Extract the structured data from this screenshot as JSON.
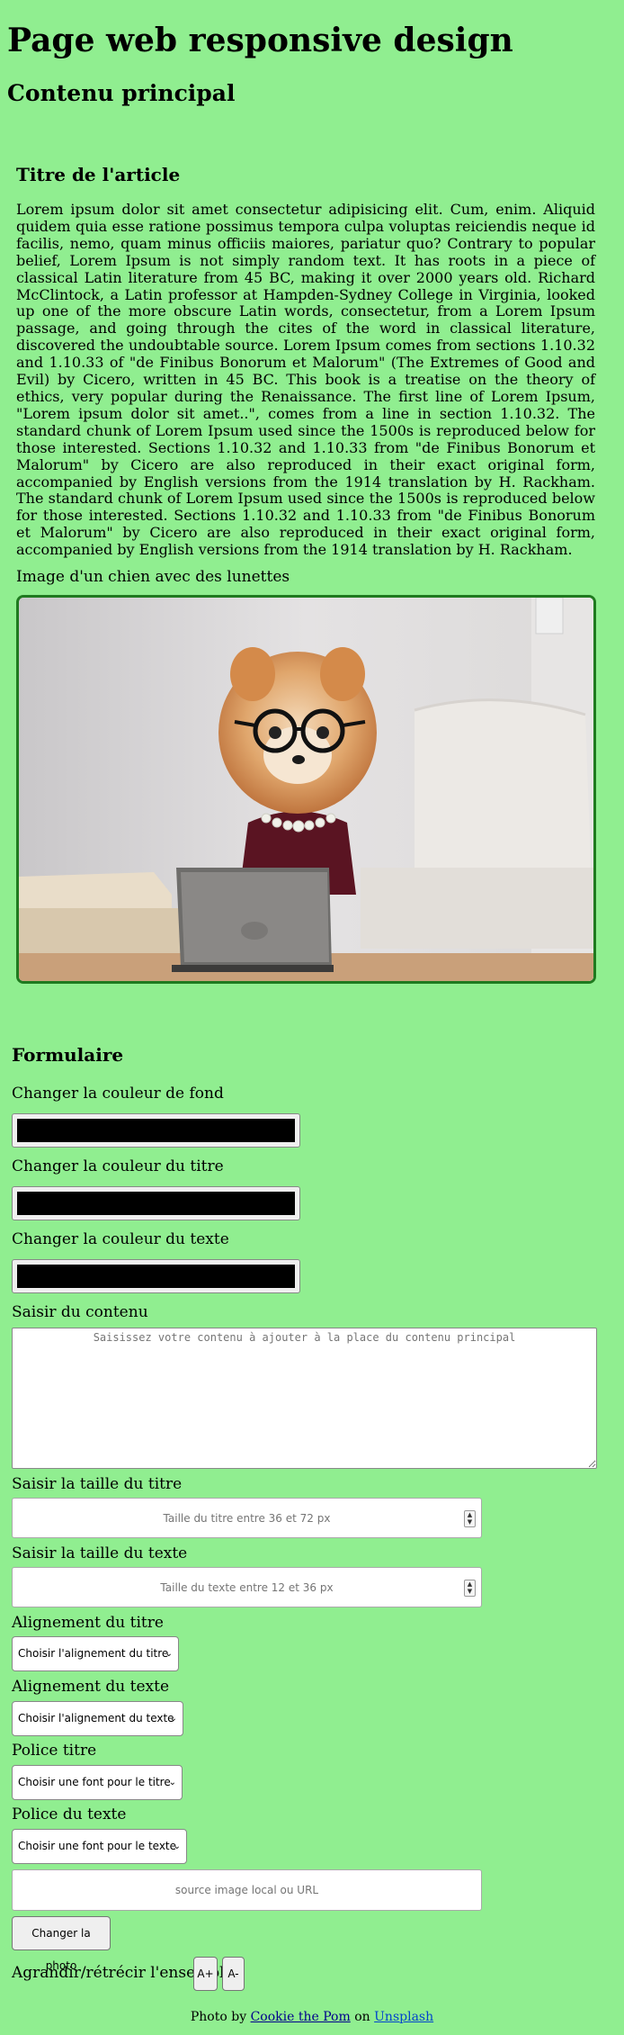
{
  "header": {
    "title": "Page web responsive design"
  },
  "main": {
    "title": "Contenu principal",
    "article": {
      "title": "Titre de l'article",
      "text": "Lorem ipsum dolor sit amet consectetur adipisicing elit. Cum, enim. Aliquid quidem quia esse ratione possimus tempora culpa voluptas reiciendis neque id facilis, nemo, quam minus officiis maiores, pariatur quo? Contrary to popular belief, Lorem Ipsum is not simply random text. It has roots in a piece of classical Latin literature from 45 BC, making it over 2000 years old. Richard McClintock, a Latin professor at Hampden-Sydney College in Virginia, looked up one of the more obscure Latin words, consectetur, from a Lorem Ipsum passage, and going through the cites of the word in classical literature, discovered the undoubtable source. Lorem Ipsum comes from sections 1.10.32 and 1.10.33 of \"de Finibus Bonorum et Malorum\" (The Extremes of Good and Evil) by Cicero, written in 45 BC. This book is a treatise on the theory of ethics, very popular during the Renaissance. The first line of Lorem Ipsum, \"Lorem ipsum dolor sit amet..\", comes from a line in section 1.10.32. The standard chunk of Lorem Ipsum used since the 1500s is reproduced below for those interested. Sections 1.10.32 and 1.10.33 from \"de Finibus Bonorum et Malorum\" by Cicero are also reproduced in their exact original form, accompanied by English versions from the 1914 translation by H. Rackham. The standard chunk of Lorem Ipsum used since the 1500s is reproduced below for those interested. Sections 1.10.32 and 1.10.33 from \"de Finibus Bonorum et Malorum\" by Cicero are also reproduced in their exact original form, accompanied by English versions from the 1914 translation by H. Rackham.",
      "image_caption": "Image d'un chien avec des lunettes"
    }
  },
  "form": {
    "title": "Formulaire",
    "bg_color_label": "Changer la couleur de fond",
    "bg_color_value": "#000000",
    "title_color_label": "Changer la couleur du titre",
    "title_color_value": "#000000",
    "text_color_label": "Changer la couleur du texte",
    "text_color_value": "#000000",
    "content_label": "Saisir du contenu",
    "content_placeholder": "Saisissez votre contenu à ajouter à la place du contenu principal",
    "title_size_label": "Saisir la taille du titre",
    "title_size_placeholder": "Taille du titre entre 36 et 72 px",
    "text_size_label": "Saisir la taille du texte",
    "text_size_placeholder": "Taille du texte entre 12 et 36 px",
    "title_align_label": "Alignement du titre",
    "title_align_selected": "Choisir l'alignement du titre",
    "text_align_label": "Alignement du texte",
    "text_align_selected": "Choisir l'alignement du texte",
    "title_font_label": "Police titre",
    "title_font_selected": "Choisir une font pour le titre",
    "text_font_label": "Police du texte",
    "text_font_selected": "Choisir une font pour le texte",
    "image_source_placeholder": "source image local ou URL",
    "change_photo_button": "Changer la photo",
    "zoom_label": "Agrandir/rétrécir l'ensemble",
    "zoom_in_button": "A+",
    "zoom_out_button": "A-"
  },
  "footer": {
    "prefix": "Photo by",
    "author": "Cookie the Pom",
    "middle": "on",
    "site": "Unsplash"
  },
  "colors": {
    "page_background": "#90ee90",
    "image_border": "#1f7a1f"
  }
}
